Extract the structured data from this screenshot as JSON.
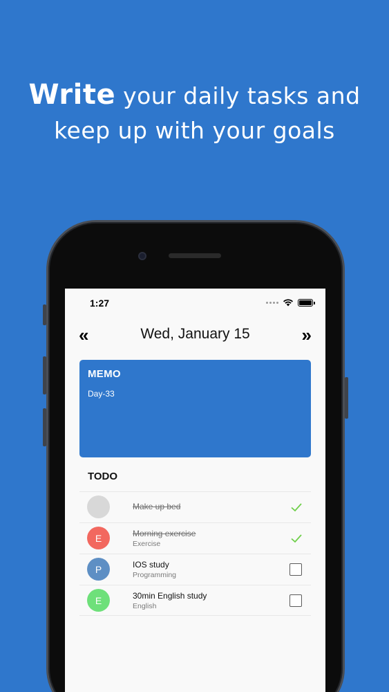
{
  "headline": {
    "emphasis": "Write",
    "line1_rest": " your daily tasks and",
    "line2": "keep up with your goals"
  },
  "status_bar": {
    "time": "1:27"
  },
  "nav": {
    "prev": "«",
    "next": "»",
    "date": "Wed, January 15"
  },
  "memo": {
    "title": "MEMO",
    "body": "Day-33",
    "color": "#2f77cc"
  },
  "todo": {
    "title": "TODO",
    "items": [
      {
        "initial": "",
        "label": "Make up bed",
        "category": "",
        "done": true,
        "avatar_color": "#d8d8d8"
      },
      {
        "initial": "E",
        "label": "Morning exercise",
        "category": "Exercise",
        "done": true,
        "avatar_color": "#f2685f"
      },
      {
        "initial": "P",
        "label": "IOS study",
        "category": "Programming",
        "done": false,
        "avatar_color": "#5e8fc4"
      },
      {
        "initial": "E",
        "label": "30min English study",
        "category": "English",
        "done": false,
        "avatar_color": "#6ee07a"
      }
    ]
  },
  "colors": {
    "background": "#2f77cc",
    "check": "#6fcf4a"
  }
}
